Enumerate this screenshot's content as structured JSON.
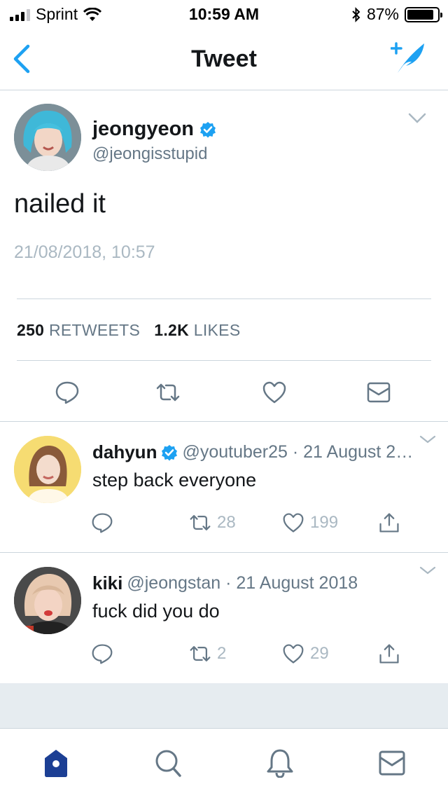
{
  "status_bar": {
    "carrier": "Sprint",
    "time": "10:59 AM",
    "battery_percent": "87%",
    "battery_level": 0.87
  },
  "nav": {
    "title": "Tweet",
    "back_icon": "chevron-left-icon",
    "compose_icon": "compose-feather-icon"
  },
  "main_tweet": {
    "display_name": "jeongyeon",
    "handle": "@jeongisstupid",
    "verified": true,
    "text": "nailed it",
    "timestamp": "21/08/2018, 10:57",
    "retweets_count": "250",
    "retweets_label": "RETWEETS",
    "likes_count": "1.2K",
    "likes_label": "LIKES"
  },
  "replies": [
    {
      "display_name": "dahyun",
      "verified": true,
      "meta": "@youtuber25 · 21 August 2…",
      "text": "step back everyone",
      "retweets": "28",
      "likes": "199"
    },
    {
      "display_name": "kiki",
      "verified": false,
      "meta": "@jeongstan · 21 August 2018",
      "text": "fuck did you do",
      "retweets": "2",
      "likes": "29"
    }
  ],
  "colors": {
    "accent": "#1da1f2",
    "tab_active": "#1c3f94",
    "icon_gray": "#657786",
    "meta_gray": "#aab8c2"
  }
}
